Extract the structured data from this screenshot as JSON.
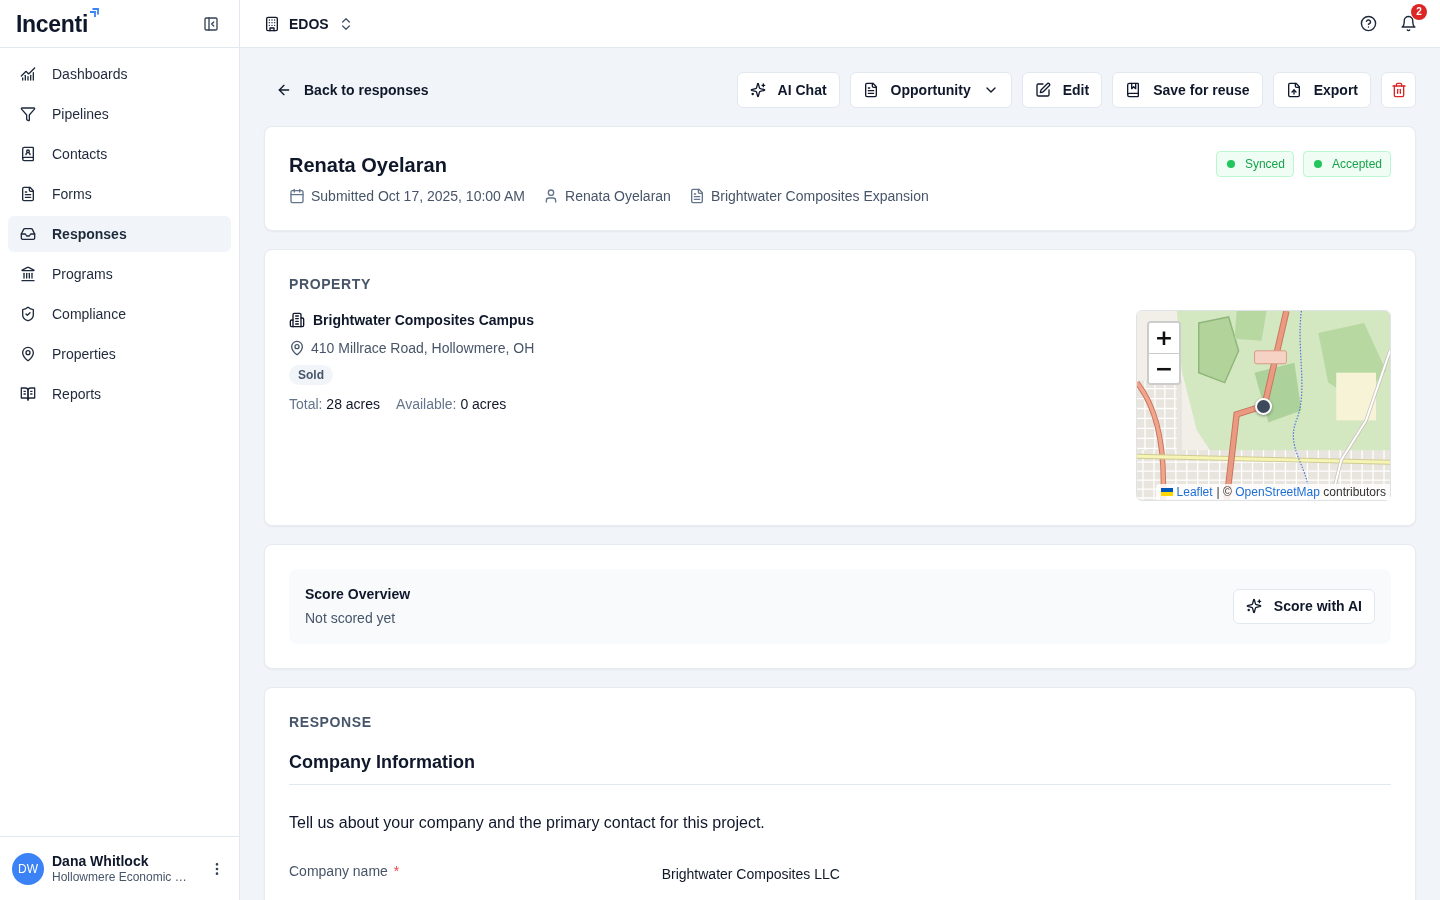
{
  "sidebar": {
    "logo": "Incenti",
    "items": [
      {
        "label": "Dashboards",
        "selected": false
      },
      {
        "label": "Pipelines",
        "selected": false
      },
      {
        "label": "Contacts",
        "selected": false
      },
      {
        "label": "Forms",
        "selected": false
      },
      {
        "label": "Responses",
        "selected": true
      },
      {
        "label": "Programs",
        "selected": false
      },
      {
        "label": "Compliance",
        "selected": false
      },
      {
        "label": "Properties",
        "selected": false
      },
      {
        "label": "Reports",
        "selected": false
      }
    ],
    "user": {
      "initials": "DW",
      "name": "Dana Whitlock",
      "organization": "Hollowmere Economic …"
    }
  },
  "topbar": {
    "workspace": "EDOS",
    "notification_count": "2"
  },
  "toolbar": {
    "back": "Back to responses",
    "buttons": [
      {
        "label": "AI Chat",
        "kind": "button"
      },
      {
        "label": "Opportunity",
        "kind": "menu"
      },
      {
        "label": "Edit",
        "kind": "button"
      },
      {
        "label": "Save for reuse",
        "kind": "button"
      },
      {
        "label": "Export",
        "kind": "button"
      }
    ]
  },
  "response": {
    "name": "Renata Oyelaran",
    "meta": [
      "Submitted Oct 17, 2025, 10:00 AM",
      "Renata Oyelaran",
      "Brightwater Composites Expansion"
    ],
    "badges": [
      "Synced",
      "Accepted"
    ]
  },
  "property": {
    "heading": "PROPERTY",
    "name": "Brightwater Composites Campus",
    "address": "410 Millrace Road, Hollowmere, OH",
    "status": "Sold",
    "stats": [
      {
        "label": "Total:",
        "value": "28 acres"
      },
      {
        "label": "Available:",
        "value": "0 acres"
      }
    ],
    "map": {
      "zoom_in": "+",
      "zoom_out": "−",
      "attribution": {
        "library": "Leaflet",
        "separator": "|",
        "notice": "©",
        "provider": "OpenStreetMap",
        "suffix": "contributors"
      }
    }
  },
  "score": {
    "title": "Score Overview",
    "status": "Not scored yet",
    "button": "Score with AI"
  },
  "form": {
    "heading": "RESPONSE",
    "section": "Company Information",
    "description": "Tell us about your company and the primary contact for this project.",
    "fields": [
      {
        "label": "Company name",
        "required_mark": "*",
        "value": "Brightwater Composites LLC"
      }
    ]
  }
}
